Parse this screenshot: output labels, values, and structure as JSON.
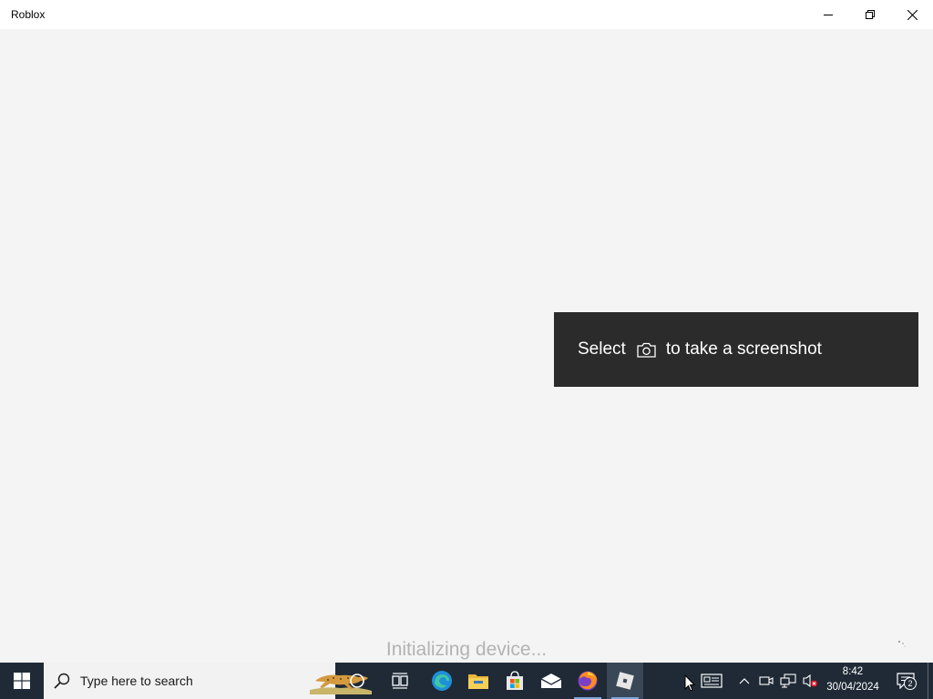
{
  "window": {
    "title": "Roblox",
    "controls": [
      "minimize",
      "maximize",
      "close"
    ]
  },
  "toast": {
    "text_before": "Select",
    "icon": "camera-icon",
    "text_after": "to take a screenshot",
    "background": "#2b2b2b"
  },
  "status": {
    "text": "Initializing device..."
  },
  "taskbar": {
    "search_placeholder": "Type here to search",
    "pinned_apps": [
      "cortana",
      "task-view",
      "edge",
      "file-explorer",
      "microsoft-store",
      "mail",
      "firefox",
      "roblox"
    ],
    "active_app": "roblox",
    "clock": {
      "time": "8:42",
      "date": "30/04/2024"
    },
    "notification_count": "2",
    "background": "#1f2a36"
  }
}
